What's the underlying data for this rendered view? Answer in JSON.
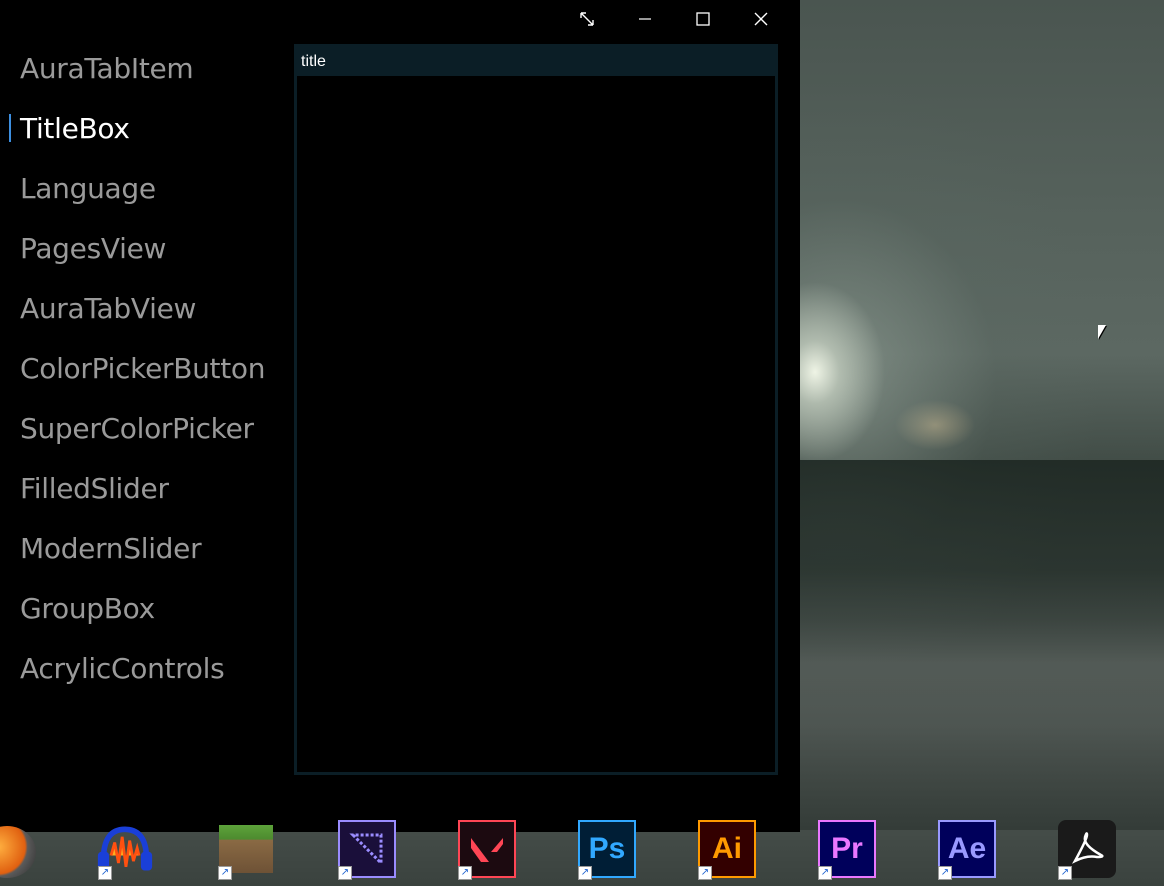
{
  "window": {
    "caption_buttons": [
      {
        "name": "resize-icon"
      },
      {
        "name": "minimize-icon"
      },
      {
        "name": "maximize-icon"
      },
      {
        "name": "close-icon"
      }
    ]
  },
  "nav": {
    "items": [
      {
        "label": "AuraTabItem",
        "selected": false
      },
      {
        "label": "TitleBox",
        "selected": true
      },
      {
        "label": "Language",
        "selected": false
      },
      {
        "label": "PagesView",
        "selected": false
      },
      {
        "label": "AuraTabView",
        "selected": false
      },
      {
        "label": "ColorPickerButton",
        "selected": false
      },
      {
        "label": "SuperColorPicker",
        "selected": false
      },
      {
        "label": "FilledSlider",
        "selected": false
      },
      {
        "label": "ModernSlider",
        "selected": false
      },
      {
        "label": "GroupBox",
        "selected": false
      },
      {
        "label": "AcrylicControls",
        "selected": false
      }
    ],
    "accent_color": "#3d8fe0"
  },
  "titlebox": {
    "title": "title",
    "header_color": "#0b1e26"
  },
  "desktop_icons": [
    {
      "name": "fl-studio-icon",
      "text": ""
    },
    {
      "name": "audacity-icon",
      "text": ""
    },
    {
      "name": "minecraft-icon",
      "text": ""
    },
    {
      "name": "media-encoder-icon",
      "text": ""
    },
    {
      "name": "valorant-icon",
      "text": ""
    },
    {
      "name": "photoshop-icon",
      "text": "Ps"
    },
    {
      "name": "illustrator-icon",
      "text": "Ai"
    },
    {
      "name": "premiere-pro-icon",
      "text": "Pr"
    },
    {
      "name": "after-effects-icon",
      "text": "Ae"
    },
    {
      "name": "acrobat-icon",
      "text": ""
    }
  ]
}
